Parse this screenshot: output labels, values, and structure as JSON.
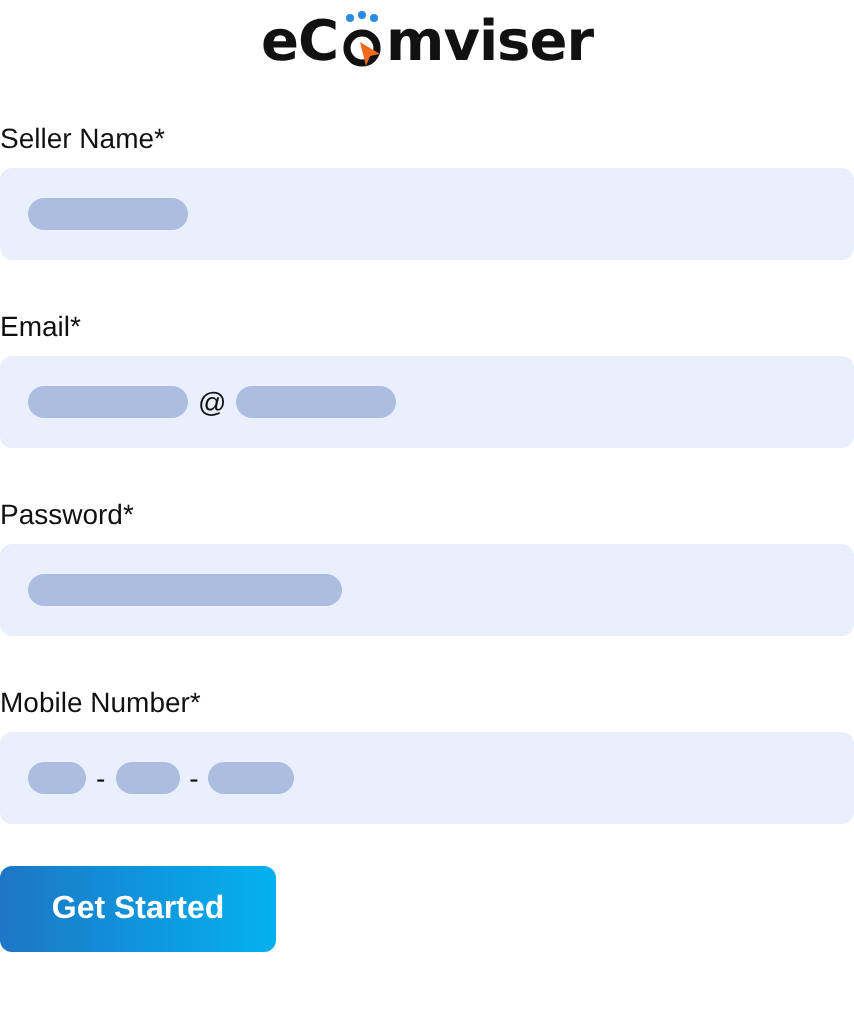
{
  "logo": {
    "before": "eC",
    "after": "mviser"
  },
  "fields": [
    {
      "label": "Seller Name*",
      "segments": [
        {
          "kind": "long"
        }
      ]
    },
    {
      "label": "Email*",
      "segments": [
        {
          "kind": "long"
        },
        {
          "kind": "separator",
          "text": "@"
        },
        {
          "kind": "long"
        }
      ]
    },
    {
      "label": "Password*",
      "segments": [
        {
          "kind": "wide"
        }
      ]
    },
    {
      "label": "Mobile Number*",
      "segments": [
        {
          "kind": "tiny"
        },
        {
          "kind": "separator",
          "text": "-"
        },
        {
          "kind": "short"
        },
        {
          "kind": "separator",
          "text": "-"
        },
        {
          "kind": "medium"
        }
      ]
    }
  ],
  "button": "Get Started"
}
